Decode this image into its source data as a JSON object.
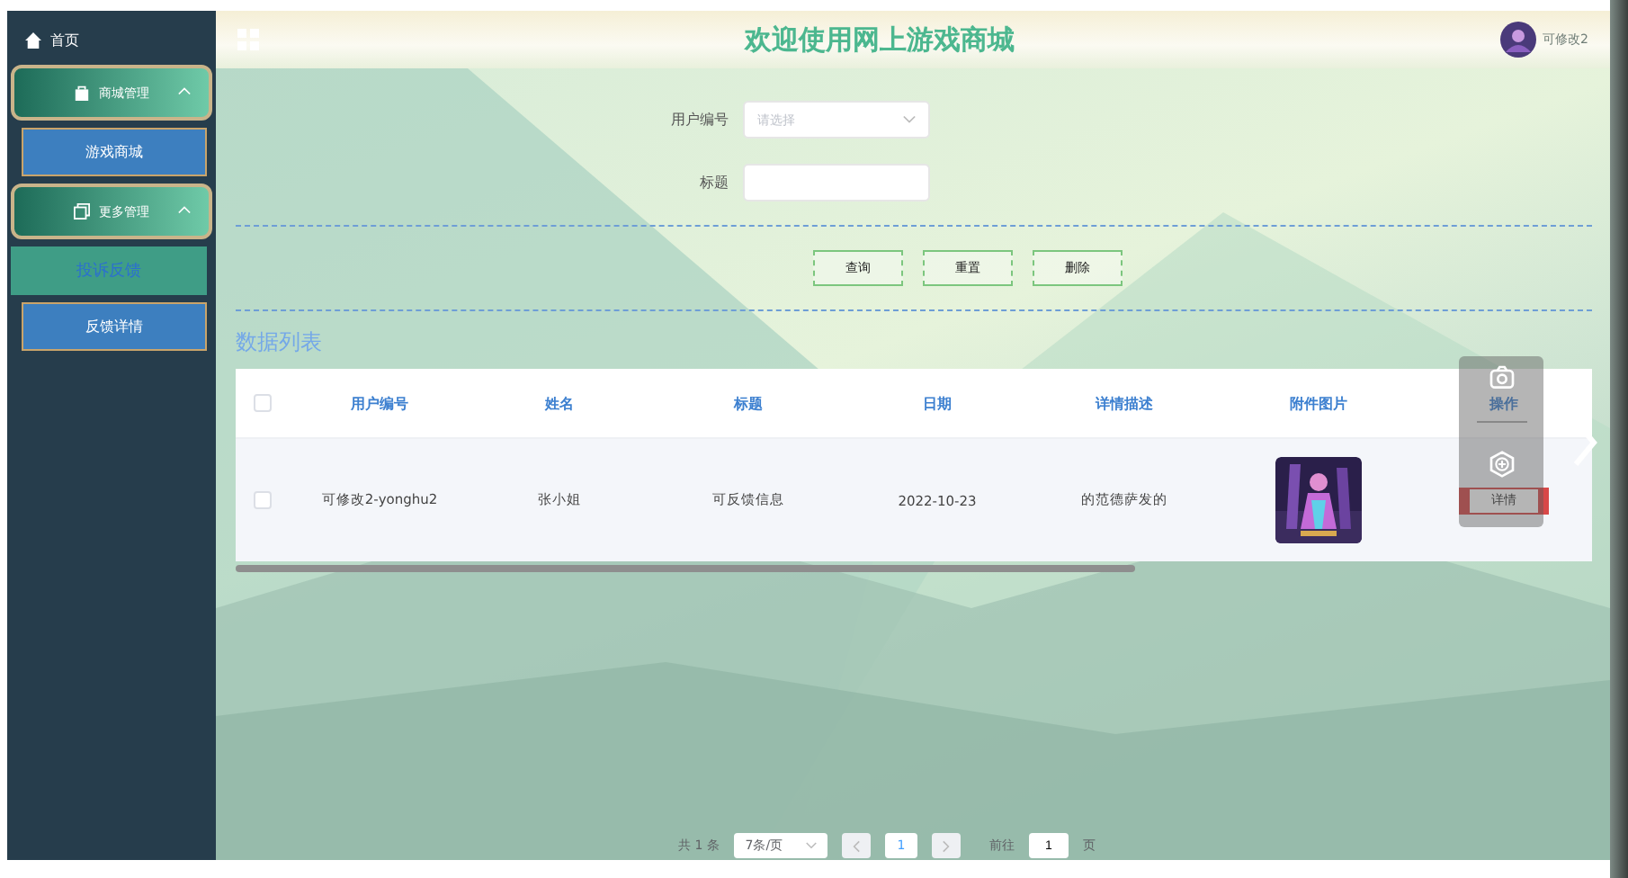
{
  "header": {
    "title": "欢迎使用网上游戏商城",
    "username": "可修改2"
  },
  "sidebar": {
    "items": [
      {
        "label": "首页",
        "kind": "link"
      },
      {
        "label": "商城管理",
        "kind": "group",
        "expanded": true,
        "children": [
          {
            "label": "游戏商城",
            "selected": false
          }
        ]
      },
      {
        "label": "更多管理",
        "kind": "group",
        "expanded": true,
        "children": [
          {
            "label": "投诉反馈",
            "selected": true
          },
          {
            "label": "反馈详情",
            "selected": false
          }
        ]
      }
    ]
  },
  "search_form": {
    "fields": [
      {
        "label": "用户编号",
        "kind": "select",
        "placeholder": "请选择"
      },
      {
        "label": "标题",
        "kind": "input"
      }
    ],
    "buttons": [
      "查询",
      "重置",
      "删除"
    ]
  },
  "list": {
    "title": "数据列表",
    "header_checked": false,
    "columns": [
      "用户编号",
      "姓名",
      "标题",
      "日期",
      "详情描述",
      "附件图片",
      "操作"
    ],
    "rows": [
      {
        "checked": false,
        "cells": [
          "可修改2-yonghu2",
          "张小姐",
          "可反馈信息",
          "2022-10-23",
          "的范德萨发的"
        ],
        "action": "详情"
      }
    ]
  },
  "pagination": {
    "total": "共 1 条",
    "page_size": "7条/页",
    "pages": [
      {
        "label": "1",
        "selected": true
      }
    ],
    "goto_label": "前往",
    "goto_value": "1",
    "goto_suffix": "页"
  }
}
